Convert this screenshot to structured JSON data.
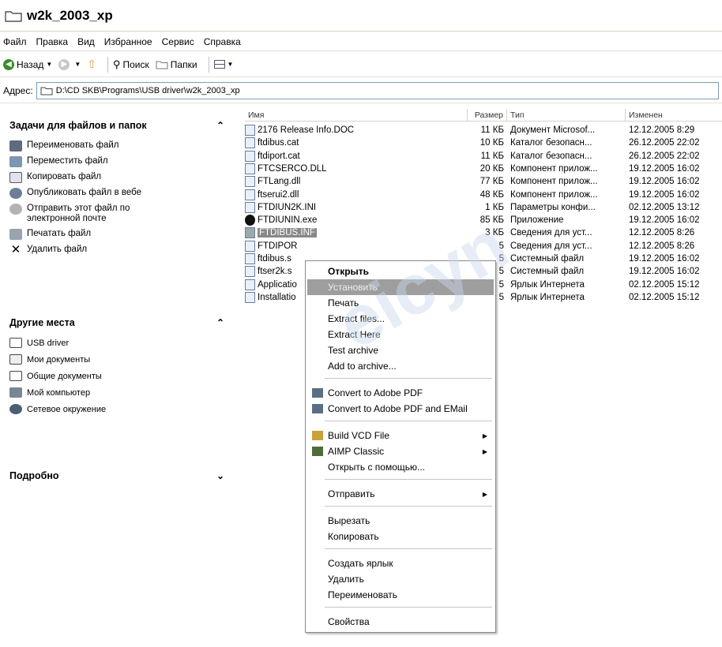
{
  "window": {
    "title": "w2k_2003_xp"
  },
  "menu": [
    "Файл",
    "Правка",
    "Вид",
    "Избранное",
    "Сервис",
    "Справка"
  ],
  "toolbar": {
    "back": "Назад",
    "search": "Поиск",
    "folders": "Папки"
  },
  "address": {
    "label": "Адрес:",
    "path": "D:\\CD SKB\\Programs\\USB driver\\w2k_2003_xp"
  },
  "tasks": {
    "title": "Задачи для файлов и папок",
    "items": [
      "Переименовать файл",
      "Переместить файл",
      "Копировать файл",
      "Опубликовать файл в вебе",
      "Отправить этот файл по электронной почте",
      "Печатать файл",
      "Удалить файл"
    ]
  },
  "places": {
    "title": "Другие места",
    "items": [
      "USB driver",
      "Мои документы",
      "Общие документы",
      "Мой компьютер",
      "Сетевое окружение"
    ]
  },
  "details": {
    "title": "Подробно"
  },
  "columns": {
    "name": "Имя",
    "size": "Размер",
    "type": "Тип",
    "modified": "Изменен"
  },
  "files": [
    {
      "name": "2176 Release Info.DOC",
      "size": "11 КБ",
      "type": "Документ Microsof...",
      "modified": "12.12.2005 8:29"
    },
    {
      "name": "ftdibus.cat",
      "size": "10 КБ",
      "type": "Каталог безопасн...",
      "modified": "26.12.2005 22:02"
    },
    {
      "name": "ftdiport.cat",
      "size": "11 КБ",
      "type": "Каталог безопасн...",
      "modified": "26.12.2005 22:02"
    },
    {
      "name": "FTCSERCO.DLL",
      "size": "20 КБ",
      "type": "Компонент прилож...",
      "modified": "19.12.2005 16:02"
    },
    {
      "name": "FTLang.dll",
      "size": "77 КБ",
      "type": "Компонент прилож...",
      "modified": "19.12.2005 16:02"
    },
    {
      "name": "ftserui2.dll",
      "size": "48 КБ",
      "type": "Компонент прилож...",
      "modified": "19.12.2005 16:02"
    },
    {
      "name": "FTDIUN2K.INI",
      "size": "1 КБ",
      "type": "Параметры конфи...",
      "modified": "02.12.2005 13:12"
    },
    {
      "name": "FTDIUNIN.exe",
      "size": "85 КБ",
      "type": "Приложение",
      "modified": "19.12.2005 16:02"
    },
    {
      "name": "FTDIBUS.INF",
      "size": "3 КБ",
      "type": "Сведения для уст...",
      "modified": "12.12.2005 8:26"
    },
    {
      "name": "FTDIPOR",
      "size": "5",
      "type": "Сведения для уст...",
      "modified": "12.12.2005 8:26"
    },
    {
      "name": "ftdibus.s",
      "size": "5",
      "type": "Системный файл",
      "modified": "19.12.2005 16:02"
    },
    {
      "name": "ftser2k.s",
      "size": "5",
      "type": "Системный файл",
      "modified": "19.12.2005 16:02"
    },
    {
      "name": "Applicatio",
      "size": "5",
      "type": "Ярлык Интернета",
      "modified": "02.12.2005 15:12"
    },
    {
      "name": "Installatio",
      "size": "5",
      "type": "Ярлык Интернета",
      "modified": "02.12.2005 15:12"
    }
  ],
  "context_menu": [
    "Открыть",
    "Установить",
    "Печать",
    "Extract files...",
    "Extract Here",
    "Test archive",
    "Add to archive...",
    "Convert to Adobe PDF",
    "Convert to Adobe PDF and EMail",
    "Build VCD File",
    "AIMP Classic",
    "Открыть с помощью...",
    "Отправить",
    "Вырезать",
    "Копировать",
    "Создать ярлык",
    "Удалить",
    "Переименовать",
    "Свойства"
  ],
  "watermark": "eicyn"
}
